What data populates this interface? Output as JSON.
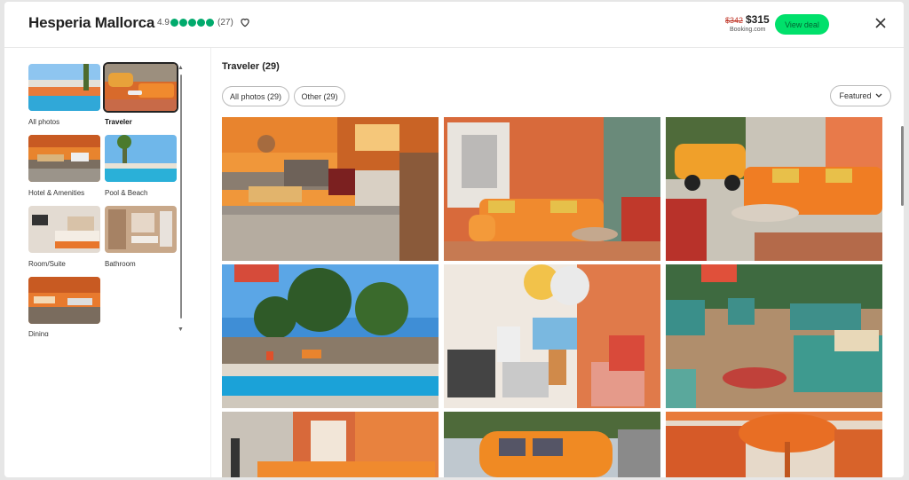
{
  "header": {
    "title": "Hesperia Mallorca",
    "rating": "4.9",
    "reviews": "(27)",
    "rating_bubbles": 5,
    "old_price": "$342",
    "price": "$315",
    "provider": "Booking.com",
    "cta": "View deal"
  },
  "sidebar": {
    "categories": [
      {
        "label": "All photos"
      },
      {
        "label": "Traveler"
      },
      {
        "label": "Hotel & Amenities"
      },
      {
        "label": "Pool & Beach"
      },
      {
        "label": "Room/Suite"
      },
      {
        "label": "Bathroom"
      },
      {
        "label": "Dining"
      }
    ]
  },
  "main": {
    "title": "Traveler (29)",
    "filters": [
      "All photos (29)",
      "Other (29)"
    ],
    "sort_label": "Featured"
  },
  "colors": {
    "accent_green": "#00e06b",
    "rating_green": "#00aa6c",
    "orange": "#e8762b"
  }
}
